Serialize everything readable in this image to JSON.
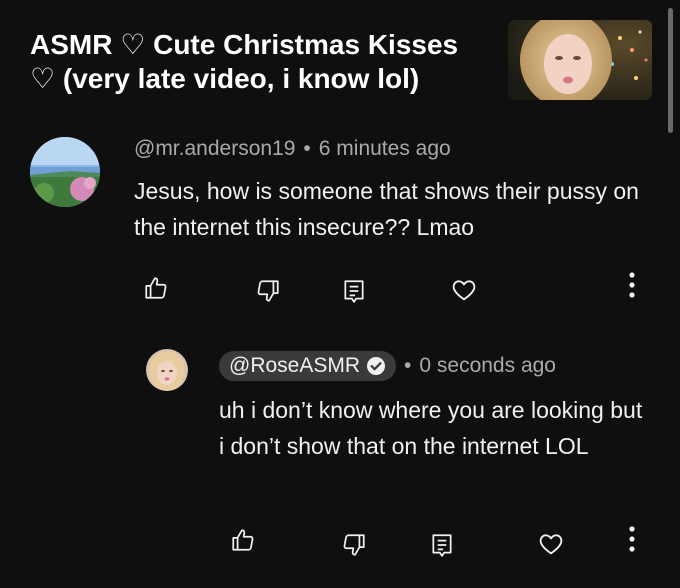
{
  "video": {
    "title": "ASMR ♡ Cute Christmas Kisses ♡ (very late video, i know lol)"
  },
  "comment": {
    "author": "@mr.anderson19",
    "time": "6 minutes ago",
    "text": "Jesus, how is someone that shows their pussy on the internet this insecure?? Lmao"
  },
  "reply": {
    "author": "@RoseASMR",
    "verified": true,
    "time": "0 seconds ago",
    "text": "uh i don’t know where you are looking but i don’t show that on the internet LOL"
  },
  "icons": {
    "like": "thumbs-up-icon",
    "dislike": "thumbs-down-icon",
    "reply": "comment-icon",
    "heart": "heart-icon",
    "more": "more-vertical-icon"
  },
  "colors": {
    "background": "#0f0f0f",
    "text": "#f1f1f1",
    "secondary_text": "#aaaaaa",
    "channel_pill": "#3a3a3a"
  }
}
